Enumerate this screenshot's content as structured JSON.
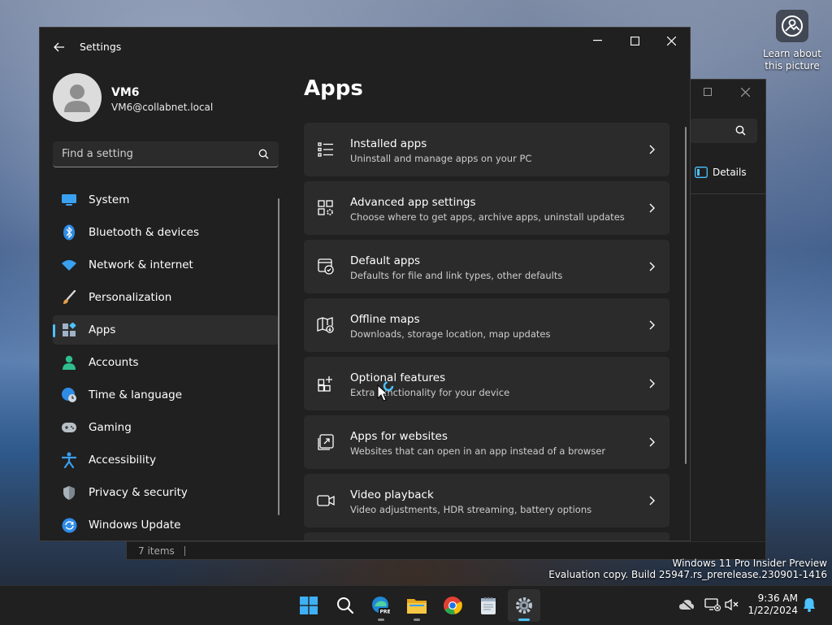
{
  "desktop": {
    "learn_about_label": "Learn about this picture",
    "watermark_line1": "Windows 11 Pro Insider Preview",
    "watermark_line2": "Evaluation copy. Build 25947.rs_prerelease.230901-1416"
  },
  "explorer": {
    "details_label": "Details",
    "status_items": "7 items"
  },
  "settings": {
    "title": "Settings",
    "user": {
      "name": "VM6",
      "email": "VM6@collabnet.local"
    },
    "search": {
      "placeholder": "Find a setting"
    },
    "nav": [
      {
        "label": "System",
        "icon": "system-monitor-icon"
      },
      {
        "label": "Bluetooth & devices",
        "icon": "bluetooth-icon"
      },
      {
        "label": "Network & internet",
        "icon": "wifi-icon"
      },
      {
        "label": "Personalization",
        "icon": "paintbrush-icon"
      },
      {
        "label": "Apps",
        "icon": "apps-icon",
        "active": true
      },
      {
        "label": "Accounts",
        "icon": "person-icon"
      },
      {
        "label": "Time & language",
        "icon": "globe-clock-icon"
      },
      {
        "label": "Gaming",
        "icon": "gamepad-icon"
      },
      {
        "label": "Accessibility",
        "icon": "accessibility-icon"
      },
      {
        "label": "Privacy & security",
        "icon": "shield-icon"
      },
      {
        "label": "Windows Update",
        "icon": "windows-update-icon"
      }
    ],
    "page_title": "Apps",
    "cards": [
      {
        "title": "Installed apps",
        "subtitle": "Uninstall and manage apps on your PC",
        "icon": "list-icon"
      },
      {
        "title": "Advanced app settings",
        "subtitle": "Choose where to get apps, archive apps, uninstall updates",
        "icon": "app-settings-icon"
      },
      {
        "title": "Default apps",
        "subtitle": "Defaults for file and link types, other defaults",
        "icon": "default-apps-icon"
      },
      {
        "title": "Offline maps",
        "subtitle": "Downloads, storage location, map updates",
        "icon": "map-icon"
      },
      {
        "title": "Optional features",
        "subtitle": "Extra functionality for your device",
        "icon": "optional-features-icon"
      },
      {
        "title": "Apps for websites",
        "subtitle": "Websites that can open in an app instead of a browser",
        "icon": "open-in-app-icon"
      },
      {
        "title": "Video playback",
        "subtitle": "Video adjustments, HDR streaming, battery options",
        "icon": "video-icon"
      }
    ]
  },
  "taskbar": {
    "apps": [
      "start-icon",
      "search-icon",
      "edge-beta-icon",
      "file-explorer-icon",
      "chrome-icon",
      "notepad-icon",
      "settings-icon"
    ],
    "time": "9:36 AM",
    "date": "1/22/2024"
  },
  "colors": {
    "accent": "#4cc2ff",
    "window_bg": "#202020",
    "card_bg": "#2b2b2b"
  }
}
